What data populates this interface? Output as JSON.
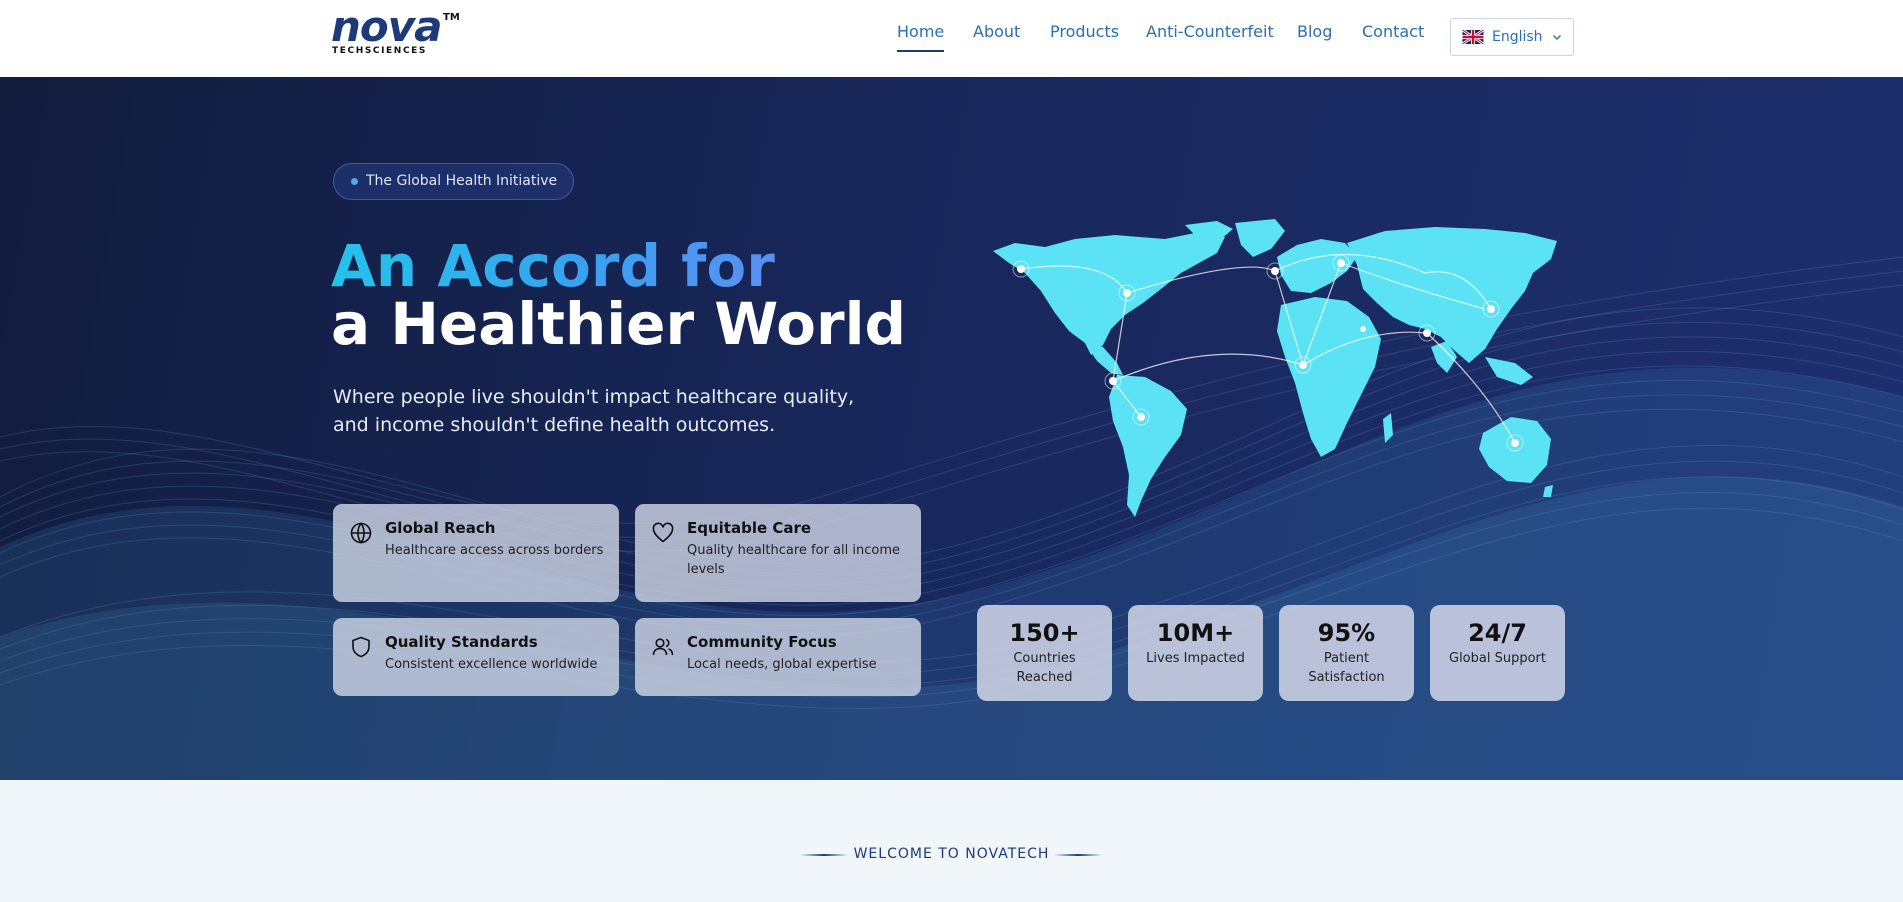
{
  "brand": {
    "logo_word": "nova",
    "logo_tm": "TM",
    "logo_sub": "TECHSCIENCES"
  },
  "nav": {
    "items": [
      {
        "label": "Home",
        "active": true
      },
      {
        "label": "About"
      },
      {
        "label": "Products"
      },
      {
        "label": "Anti-Counterfeit"
      },
      {
        "label": "Blog"
      },
      {
        "label": "Contact"
      }
    ],
    "language": {
      "label": "English",
      "flag_icon": "uk-flag-icon"
    }
  },
  "hero": {
    "badge": "The Global Health Initiative",
    "title_line1": "An Accord for",
    "title_line2": "a Healthier World",
    "lead": "Where people live shouldn't impact healthcare quality, and income shouldn't define health outcomes.",
    "features": [
      {
        "icon": "globe-icon",
        "title": "Global Reach",
        "desc": "Healthcare access across borders"
      },
      {
        "icon": "heart-icon",
        "title": "Equitable Care",
        "desc": "Quality healthcare for all income levels"
      },
      {
        "icon": "shield-icon",
        "title": "Quality Standards",
        "desc": "Consistent excellence worldwide"
      },
      {
        "icon": "users-icon",
        "title": "Community Focus",
        "desc": "Local needs, global expertise"
      }
    ],
    "stats": [
      {
        "value": "150+",
        "label": "Countries Reached"
      },
      {
        "value": "10M+",
        "label": "Lives Impacted"
      },
      {
        "value": "95%",
        "label": "Patient Satisfaction"
      },
      {
        "value": "24/7",
        "label": "Global Support"
      }
    ]
  },
  "welcome": {
    "eyebrow": "WELCOME TO NOVATECH"
  },
  "colors": {
    "accent": "#2a6fb3",
    "hero_bg": "#18275a",
    "map_land": "#5be3f5",
    "title_gradient_start": "#24c3ea"
  }
}
